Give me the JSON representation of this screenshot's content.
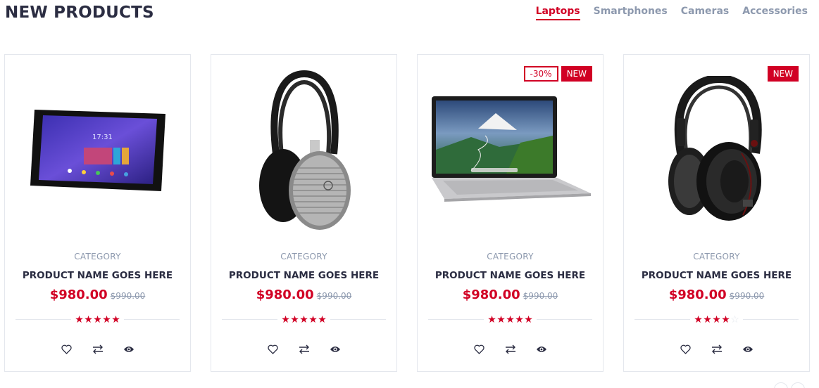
{
  "section": {
    "title": "NEW PRODUCTS",
    "tabs": [
      {
        "label": "Laptops",
        "active": true
      },
      {
        "label": "Smartphones",
        "active": false
      },
      {
        "label": "Cameras",
        "active": false
      },
      {
        "label": "Accessories",
        "active": false
      }
    ]
  },
  "colors": {
    "accent": "#d10024",
    "text": "#2b2d42",
    "muted": "#8d99ae",
    "border": "#e4e7ed"
  },
  "products": [
    {
      "image": "tablet",
      "category": "CATEGORY",
      "name": "PRODUCT NAME GOES HERE",
      "price": "$980.00",
      "old_price": "$990.00",
      "rating": 5,
      "rating_max": 5,
      "sale_label": null,
      "new_label": null
    },
    {
      "image": "headphones-silver",
      "category": "CATEGORY",
      "name": "PRODUCT NAME GOES HERE",
      "price": "$980.00",
      "old_price": "$990.00",
      "rating": 5,
      "rating_max": 5,
      "sale_label": null,
      "new_label": null
    },
    {
      "image": "laptop",
      "category": "CATEGORY",
      "name": "PRODUCT NAME GOES HERE",
      "price": "$980.00",
      "old_price": "$990.00",
      "rating": 5,
      "rating_max": 5,
      "sale_label": "-30%",
      "new_label": "NEW"
    },
    {
      "image": "headphones-black",
      "category": "CATEGORY",
      "name": "PRODUCT NAME GOES HERE",
      "price": "$980.00",
      "old_price": "$990.00",
      "rating": 4,
      "rating_max": 5,
      "sale_label": null,
      "new_label": "NEW"
    }
  ],
  "actions": [
    {
      "icon": "heart-icon",
      "name": "add-to-wishlist-button"
    },
    {
      "icon": "compare-icon",
      "name": "add-to-compare-button"
    },
    {
      "icon": "eye-icon",
      "name": "quick-view-button"
    }
  ]
}
